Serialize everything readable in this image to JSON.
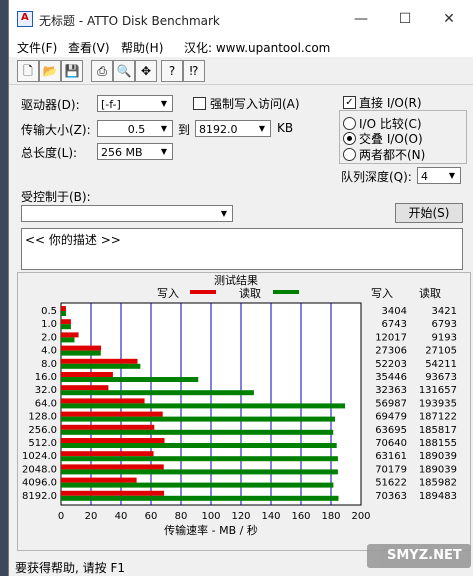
{
  "window": {
    "title": "无标题 - ATTO Disk Benchmark",
    "minimize": "—",
    "maximize": "☐",
    "close": "✕"
  },
  "menu": [
    "文件(F)",
    "查看(V)",
    "帮助(H)",
    "汉化: www.upantool.com"
  ],
  "toolbar_icons": [
    "new-file-icon",
    "open-folder-icon",
    "save-icon",
    "print-icon",
    "print-preview-icon",
    "move-icon",
    "help-icon",
    "context-help-icon"
  ],
  "controls": {
    "drive_label": "驱动器(D):",
    "drive_value": "[-f-]",
    "force_write_label": "强制写入访问(A)",
    "transfer_label": "传输大小(Z):",
    "transfer_from": "0.5",
    "to_label": "到",
    "transfer_to": "8192.0",
    "kb_label": "KB",
    "total_label": "总长度(L):",
    "total_value": "256 MB",
    "direct_io_label": "直接 I/O(R)",
    "io_compare_label": "I/O 比较(C)",
    "overlap_io_label": "交叠 I/O(O)",
    "neither_label": "两者都不(N)",
    "queue_label": "队列深度(Q):",
    "queue_value": "4",
    "controlled_label": "受控制于(B):",
    "start_button": "开始(S)",
    "description": "<<   你的描述    >>"
  },
  "chart_data": {
    "type": "bar",
    "title": "测试结果",
    "legend": [
      {
        "name": "写入",
        "color": "#e00000"
      },
      {
        "name": "读取",
        "color": "#008000"
      }
    ],
    "col_write": "写入",
    "col_read": "读取",
    "xlabel": "传输速率 - MB / 秒",
    "xlim": [
      0,
      200
    ],
    "xticks": [
      "0",
      "20",
      "40",
      "60",
      "80",
      "100",
      "120",
      "140",
      "160",
      "180",
      "200"
    ],
    "categories": [
      "0.5",
      "1.0",
      "2.0",
      "4.0",
      "8.0",
      "16.0",
      "32.0",
      "64.0",
      "128.0",
      "256.0",
      "512.0",
      "1024.0",
      "2048.0",
      "4096.0",
      "8192.0"
    ],
    "series": [
      {
        "name": "写入",
        "values": [
          3.3,
          6.6,
          11.7,
          26.7,
          51.0,
          34.6,
          31.6,
          55.7,
          67.8,
          62.2,
          69.0,
          61.7,
          68.5,
          50.4,
          68.7
        ]
      },
      {
        "name": "读取",
        "values": [
          3.3,
          6.6,
          9.0,
          26.5,
          52.9,
          91.5,
          128.6,
          189.4,
          182.7,
          181.5,
          183.8,
          184.6,
          184.6,
          181.6,
          185.0
        ]
      }
    ],
    "write_text": [
      "3404",
      "6743",
      "12017",
      "27306",
      "52203",
      "35446",
      "32363",
      "56987",
      "69479",
      "63695",
      "70640",
      "63161",
      "70179",
      "51622",
      "70363"
    ],
    "read_text": [
      "3421",
      "6793",
      "9193",
      "27105",
      "54211",
      "93673",
      "131657",
      "193935",
      "187122",
      "185817",
      "188155",
      "189039",
      "189039",
      "185982",
      "189483"
    ]
  },
  "status": "要获得帮助, 请按 F1",
  "watermark": "SMYZ.NET"
}
